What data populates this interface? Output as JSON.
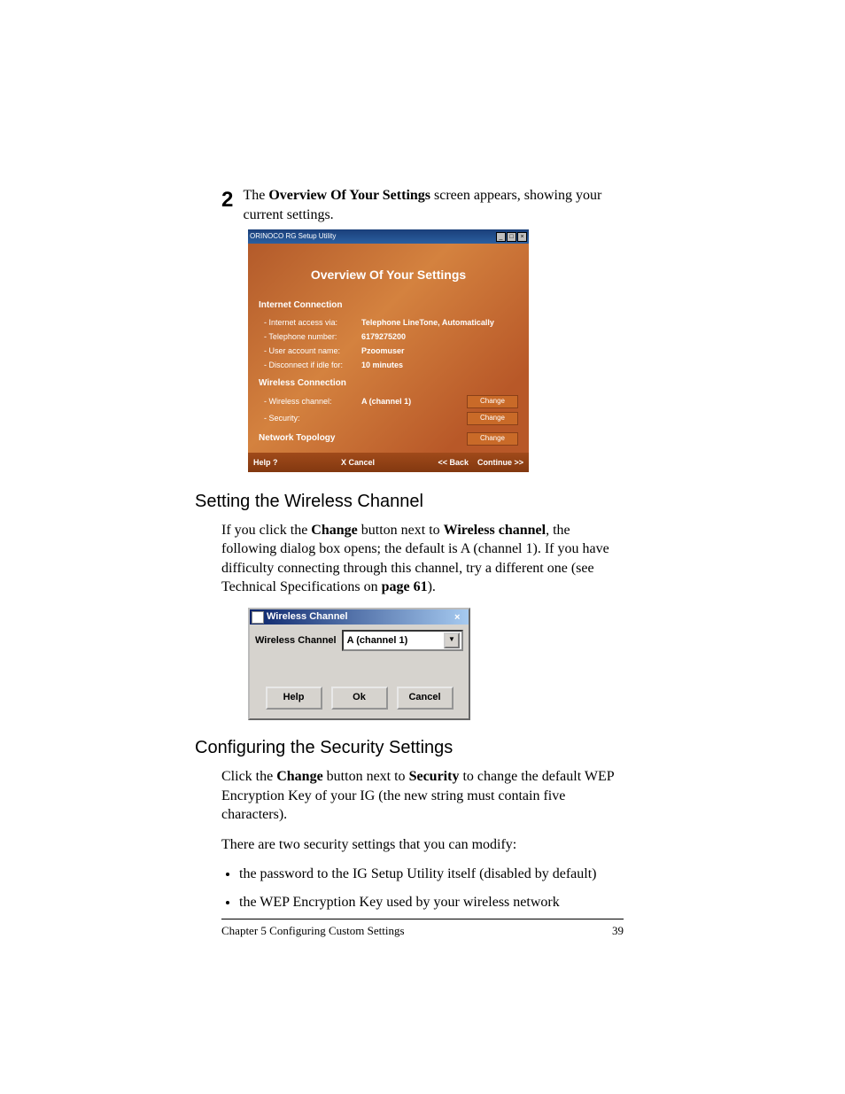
{
  "step_number": "2",
  "step_text_pre": "The ",
  "step_text_bold": "Overview Of Your Settings",
  "step_text_post": " screen appears, showing your current settings.",
  "screenshot1": {
    "window_title": "ORINOCO RG Setup Utility",
    "main_title": "Overview Of Your Settings",
    "section_internet": "Internet Connection",
    "f_access_label": "- Internet access via:",
    "f_access_val": "Telephone LineTone, Automatically",
    "f_tel_label": "- Telephone number:",
    "f_tel_val": "6179275200",
    "f_user_label": "- User account name:",
    "f_user_val": "Pzoomuser",
    "f_idle_label": "- Disconnect if idle for:",
    "f_idle_val": "10 minutes",
    "section_wireless": "Wireless Connection",
    "f_ch_label": "- Wireless channel:",
    "f_ch_val": "A (channel 1)",
    "f_sec_label": "- Security:",
    "section_topology": "Network Topology",
    "btn_change": "Change",
    "footer_help": "Help ?",
    "footer_cancel": "X Cancel",
    "footer_back": "<< Back",
    "footer_continue": "Continue >>"
  },
  "heading_wireless": "Setting the Wireless Channel",
  "para_wireless_1": "If you click the ",
  "para_wireless_b1": "Change",
  "para_wireless_2": " button next to ",
  "para_wireless_b2": "Wireless channel",
  "para_wireless_3": ", the following dialog box opens; the default is A (channel 1). If you have difficulty connecting through this channel, try a different one (see Technical Specifications on ",
  "para_wireless_b3": "page 61",
  "para_wireless_4": ").",
  "dialog": {
    "title": "Wireless Channel",
    "label": "Wireless Channel",
    "value": "A (channel 1)",
    "btn_help": "Help",
    "btn_ok": "Ok",
    "btn_cancel": "Cancel"
  },
  "heading_security": "Configuring the Security Settings",
  "para_sec_1": "Click the ",
  "para_sec_b1": "Change",
  "para_sec_2": " button next to ",
  "para_sec_b2": "Security",
  "para_sec_3": " to change the default WEP Encryption Key of your IG (the new string must contain five characters).",
  "para_sec_intro": "There are two security settings that you can modify:",
  "bullet_1": "the password to the IG Setup Utility itself (disabled by default)",
  "bullet_2": "the WEP Encryption Key used by your wireless network",
  "footer_chapter": "Chapter 5    Configuring Custom Settings",
  "footer_page": "39"
}
